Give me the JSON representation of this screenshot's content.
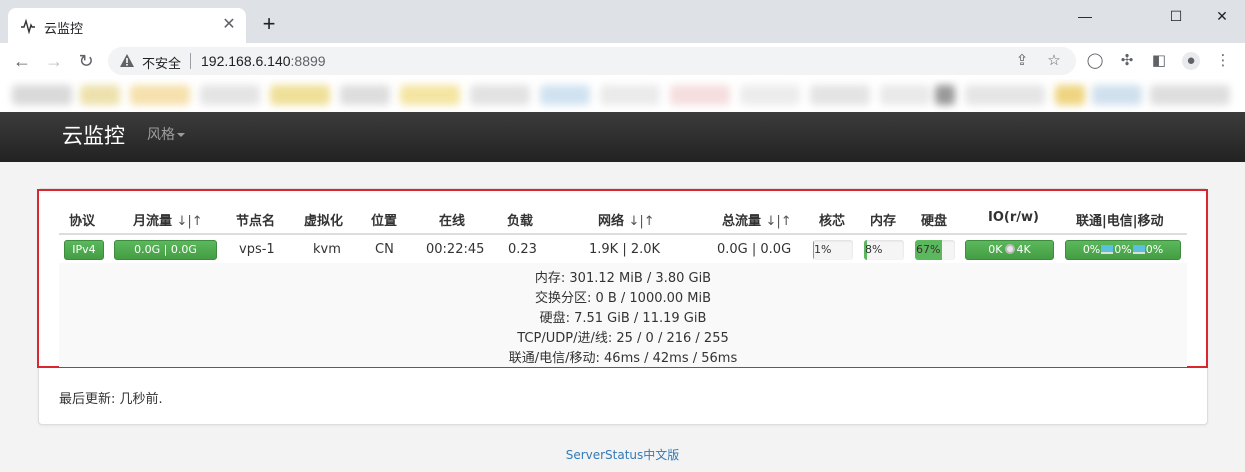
{
  "browser": {
    "tab_title": "云监控",
    "tab_close": "✕",
    "new_tab": "+",
    "win_minimize": "—",
    "win_maximize": "☐",
    "win_close": "✕",
    "insecure_label": "不安全",
    "url_host": "192.168.6.140",
    "url_port": ":8899"
  },
  "navbar": {
    "brand": "云监控",
    "style_menu": "风格"
  },
  "table": {
    "headers": {
      "protocol": "协议",
      "monthly_traffic": "月流量 ",
      "monthly_sort": "↓|↑",
      "node_name": "节点名",
      "virtualization": "虚拟化",
      "location": "位置",
      "uptime": "在线",
      "load": "负载",
      "network": "网络 ",
      "network_sort": "↓|↑",
      "total_traffic": "总流量 ",
      "total_sort": "↓|↑",
      "cpu": "核芯",
      "memory": "内存",
      "disk": "硬盘",
      "io": "IO(r/w)",
      "ping": "联通|电信|移动"
    },
    "row": {
      "protocol": "IPv4",
      "monthly_traffic": "0.0G | 0.0G",
      "node_name": "vps-1",
      "virtualization": "kvm",
      "location": "CN",
      "uptime": "00:22:45",
      "load": "0.23",
      "network": "1.9K | 2.0K",
      "total_traffic": "0.0G | 0.0G",
      "cpu_label": "1%",
      "cpu_level": 0.01,
      "memory_label": "8%",
      "memory_level": 0.08,
      "disk_label": "67%",
      "disk_level": 0.67,
      "io_read": "0K",
      "io_write": "4K",
      "ping_unicom": "0%",
      "ping_telecom": "0%",
      "ping_mobile": "0%"
    },
    "details": [
      "内存: 301.12 MiB / 3.80 GiB",
      "交换分区: 0 B / 1000.00 MiB",
      "硬盘: 7.51 GiB / 11.19 GiB",
      "TCP/UDP/进/线: 25 / 0 / 216 / 255",
      "联通/电信/移动: 46ms / 42ms / 56ms"
    ]
  },
  "last_updated": "最后更新: 几秒前.",
  "footer": "ServerStatus中文版",
  "colors": {
    "accent_green": "#5cb85c",
    "highlight_red": "#d9262f",
    "link_blue": "#337ab7",
    "navbar_dark": "#222222"
  }
}
